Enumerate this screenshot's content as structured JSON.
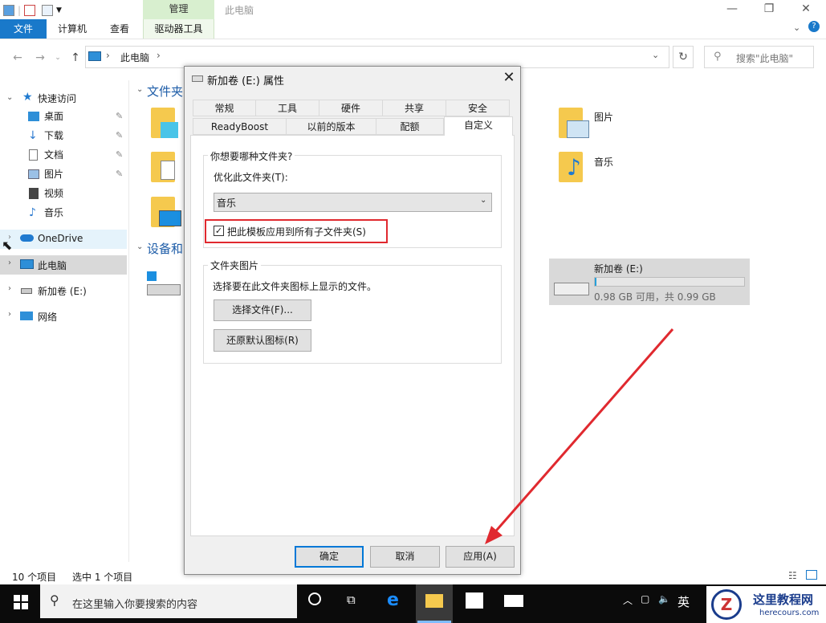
{
  "ribbon": {
    "manage_tab": "管理",
    "window_title": "此电脑",
    "tabs": [
      "文件",
      "计算机",
      "查看",
      "驱动器工具"
    ]
  },
  "address": {
    "path": "此电脑",
    "search_placeholder": "搜索\"此电脑\""
  },
  "nav": {
    "quick_access": "快速访问",
    "items": [
      "桌面",
      "下载",
      "文档",
      "图片",
      "视频",
      "音乐"
    ],
    "onedrive": "OneDrive",
    "this_pc": "此电脑",
    "drive_e": "新加卷 (E:)",
    "network": "网络"
  },
  "content": {
    "folders_header": "文件夹",
    "devices_header": "设备和",
    "pictures": "图片",
    "music": "音乐",
    "drive_name": "新加卷 (E:)",
    "drive_space": "0.98 GB 可用，共 0.99 GB",
    "drive_used_fraction": 0.01
  },
  "dialog": {
    "title": "新加卷 (E:) 属性",
    "tabs_row1": [
      "常规",
      "工具",
      "硬件",
      "共享",
      "安全"
    ],
    "tabs_row2": [
      "ReadyBoost",
      "以前的版本",
      "配额",
      "自定义"
    ],
    "group1_title": "你想要哪种文件夹?",
    "optimize_label": "优化此文件夹(T):",
    "optimize_value": "音乐",
    "apply_subfolders": "把此模板应用到所有子文件夹(S)",
    "group2_title": "文件夹图片",
    "group2_desc": "选择要在此文件夹图标上显示的文件。",
    "choose_file": "选择文件(F)...",
    "restore_default": "还原默认图标(R)",
    "ok": "确定",
    "cancel": "取消",
    "apply": "应用(A)"
  },
  "status": {
    "count": "10 个项目",
    "selected": "选中 1 个项目"
  },
  "taskbar": {
    "search_placeholder": "在这里输入你要搜索的内容",
    "ime": "英"
  },
  "watermark": {
    "name": "这里教程网",
    "url": "herecours.com"
  }
}
